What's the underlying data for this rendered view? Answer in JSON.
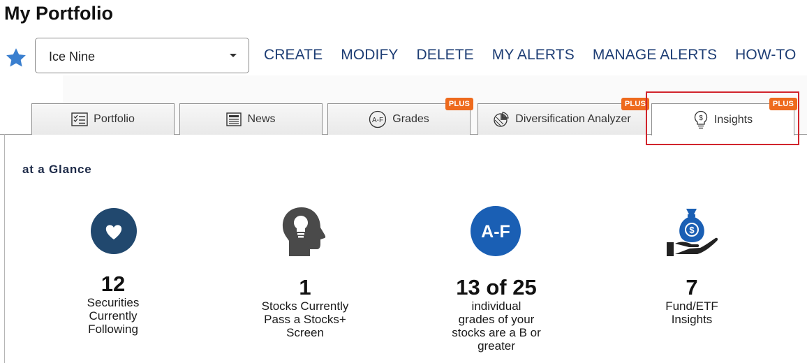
{
  "page": {
    "title": "My Portfolio"
  },
  "portfolio_select": {
    "value": "Ice Nine"
  },
  "nav": {
    "create": "CREATE",
    "modify": "MODIFY",
    "delete": "DELETE",
    "my_alerts": "MY ALERTS",
    "manage_alerts": "MANAGE ALERTS",
    "how_to": "HOW-TO"
  },
  "tabs": [
    {
      "label": "Portfolio",
      "icon": "checklist-icon",
      "plus": ""
    },
    {
      "label": "News",
      "icon": "newspaper-icon",
      "plus": ""
    },
    {
      "label": "Grades",
      "icon": "grades-af-icon",
      "plus": "PLUS"
    },
    {
      "label": "Diversification Analyzer",
      "icon": "pie-chart-icon",
      "plus": "PLUS"
    },
    {
      "label": "Insights",
      "icon": "lightbulb-dollar-icon",
      "plus": "PLUS"
    }
  ],
  "active_tab": "Insights",
  "glance": {
    "title": "at a Glance",
    "cards": [
      {
        "icon": "heart-circle-icon",
        "number": "12",
        "lines": [
          "Securities",
          "Currently",
          "Following"
        ]
      },
      {
        "icon": "head-lightbulb-icon",
        "number": "1",
        "lines": [
          "Stocks Currently",
          "Pass a Stocks+",
          "Screen"
        ]
      },
      {
        "icon": "af-grade-circle-icon",
        "icon_text": "A-F",
        "number": "13 of 25",
        "lines": [
          "individual",
          "grades of your",
          "stocks are a B or",
          "greater"
        ]
      },
      {
        "icon": "money-bag-hand-icon",
        "number": "7",
        "lines": [
          "Fund/ETF",
          "Insights"
        ]
      }
    ]
  },
  "colors": {
    "nav_link": "#1d3d74",
    "plus_badge": "#ee6a1d",
    "highlight": "#d1242c",
    "star": "#3a7fcf",
    "heart_circle": "#21486e",
    "af_circle": "#1a5fb4"
  }
}
